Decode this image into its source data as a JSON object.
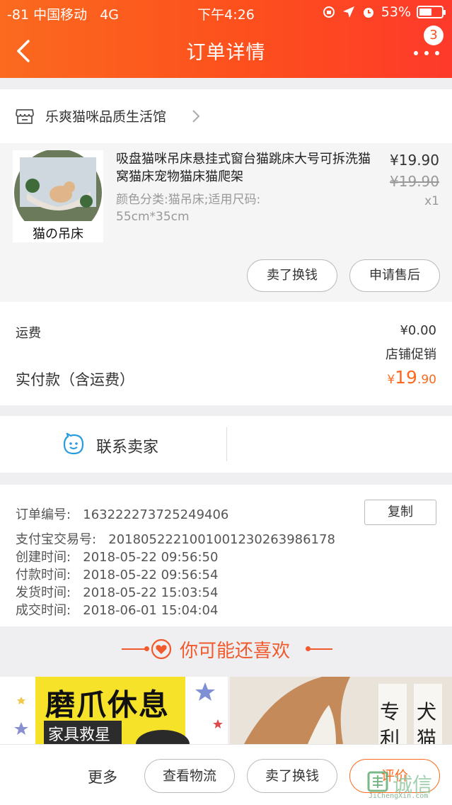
{
  "status_bar": {
    "carrier": "-81 中国移动",
    "network": "4G",
    "time": "下午4:26",
    "battery": "53%",
    "battery_level": 0.53
  },
  "header": {
    "title": "订单详情",
    "badge_count": "3"
  },
  "shop": {
    "name": "乐爽猫咪品质生活馆"
  },
  "product": {
    "name": "吸盘猫咪吊床悬挂式窗台猫跳床大号可拆洗猫窝猫床宠物猫床猫爬架",
    "sku": "颜色分类:猫吊床;适用尺码: 55cm*35cm",
    "price": "¥19.90",
    "original_price": "¥19.90",
    "quantity": "x1",
    "image_caption": "猫の吊床",
    "actions": [
      "卖了换钱",
      "申请售后"
    ]
  },
  "fees": {
    "shipping_label": "运费",
    "shipping_value": "¥0.00",
    "promo_label": "店铺促销",
    "paid_label": "实付款（含运费）",
    "paid_currency": "¥",
    "paid_int": "19",
    "paid_dec": ".90"
  },
  "contact": {
    "label": "联系卖家"
  },
  "order_info": {
    "order_no_label": "订单编号:",
    "order_no": "163222273725249406",
    "copy_label": "复制",
    "alipay_label": "支付宝交易号:",
    "alipay_no": "2018052221001001230263986178",
    "created_label": "创建时间:",
    "created": "2018-05-22 09:56:50",
    "paid_label": "付款时间:",
    "paid": "2018-05-22 09:56:54",
    "shipped_label": "发货时间:",
    "shipped": "2018-05-22 15:03:54",
    "completed_label": "成交时间:",
    "completed": "2018-06-01 15:04:04"
  },
  "recommend": {
    "title": "你可能还喜欢",
    "item1_title": "磨爪休息",
    "item1_sub": "家具救星",
    "item2_tags": [
      "专",
      "利",
      "犬",
      "猫"
    ]
  },
  "bottom_bar": {
    "more": "更多",
    "logistics": "查看物流",
    "sell": "卖了换钱",
    "review": "评价"
  },
  "watermark": {
    "text": "诚信",
    "url": "JiChengXin.com"
  },
  "colors": {
    "accent": "#fd6a1f",
    "header_start": "#fb6a1f",
    "header_end": "#fe3a2b"
  },
  "icons": [
    "back-arrow-icon",
    "more-dots-icon",
    "shop-icon",
    "chevron-right-icon",
    "contact-bubble-icon",
    "heart-icon"
  ]
}
